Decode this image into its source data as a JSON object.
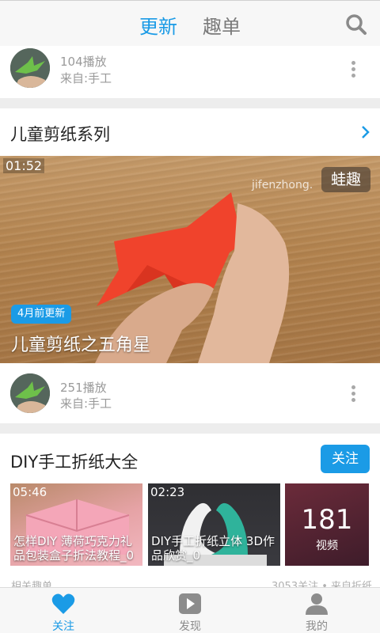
{
  "colors": {
    "accent": "#1b9be6",
    "inactive": "#7a7a7a",
    "muted": "#9a9a9a",
    "divider": "#ededed"
  },
  "header": {
    "tabs": [
      {
        "label": "更新",
        "active": true
      },
      {
        "label": "趣单",
        "active": false
      }
    ],
    "search_icon": "search-icon"
  },
  "feed": {
    "first_item": {
      "plays": "104播放",
      "from": "来自:手工"
    },
    "series": {
      "title": "儿童剪纸系列",
      "video": {
        "duration": "01:52",
        "watermark": "jifenzhong.",
        "logo": "蛙趣",
        "badge": "4月前更新",
        "title": "儿童剪纸之五角星"
      },
      "plays": "251播放",
      "from": "来自:手工"
    },
    "collection": {
      "title": "DIY手工折纸大全",
      "follow_label": "关注",
      "videos": [
        {
          "duration": "05:46",
          "caption": "怎样DIY 薄荷巧克力礼品包装盒子折法教程_0"
        },
        {
          "duration": "02:23",
          "caption": "DIY手工折纸立体 3D作品欣赏_0"
        }
      ],
      "more": {
        "count": "181",
        "label": "视频"
      },
      "meta_left": "相关趣单",
      "meta_right": "3053关注 • 来自折纸"
    }
  },
  "bottom_nav": [
    {
      "label": "关注",
      "icon": "heart-icon",
      "active": true
    },
    {
      "label": "发现",
      "icon": "play-icon",
      "active": false
    },
    {
      "label": "我的",
      "icon": "user-icon",
      "active": false
    }
  ]
}
